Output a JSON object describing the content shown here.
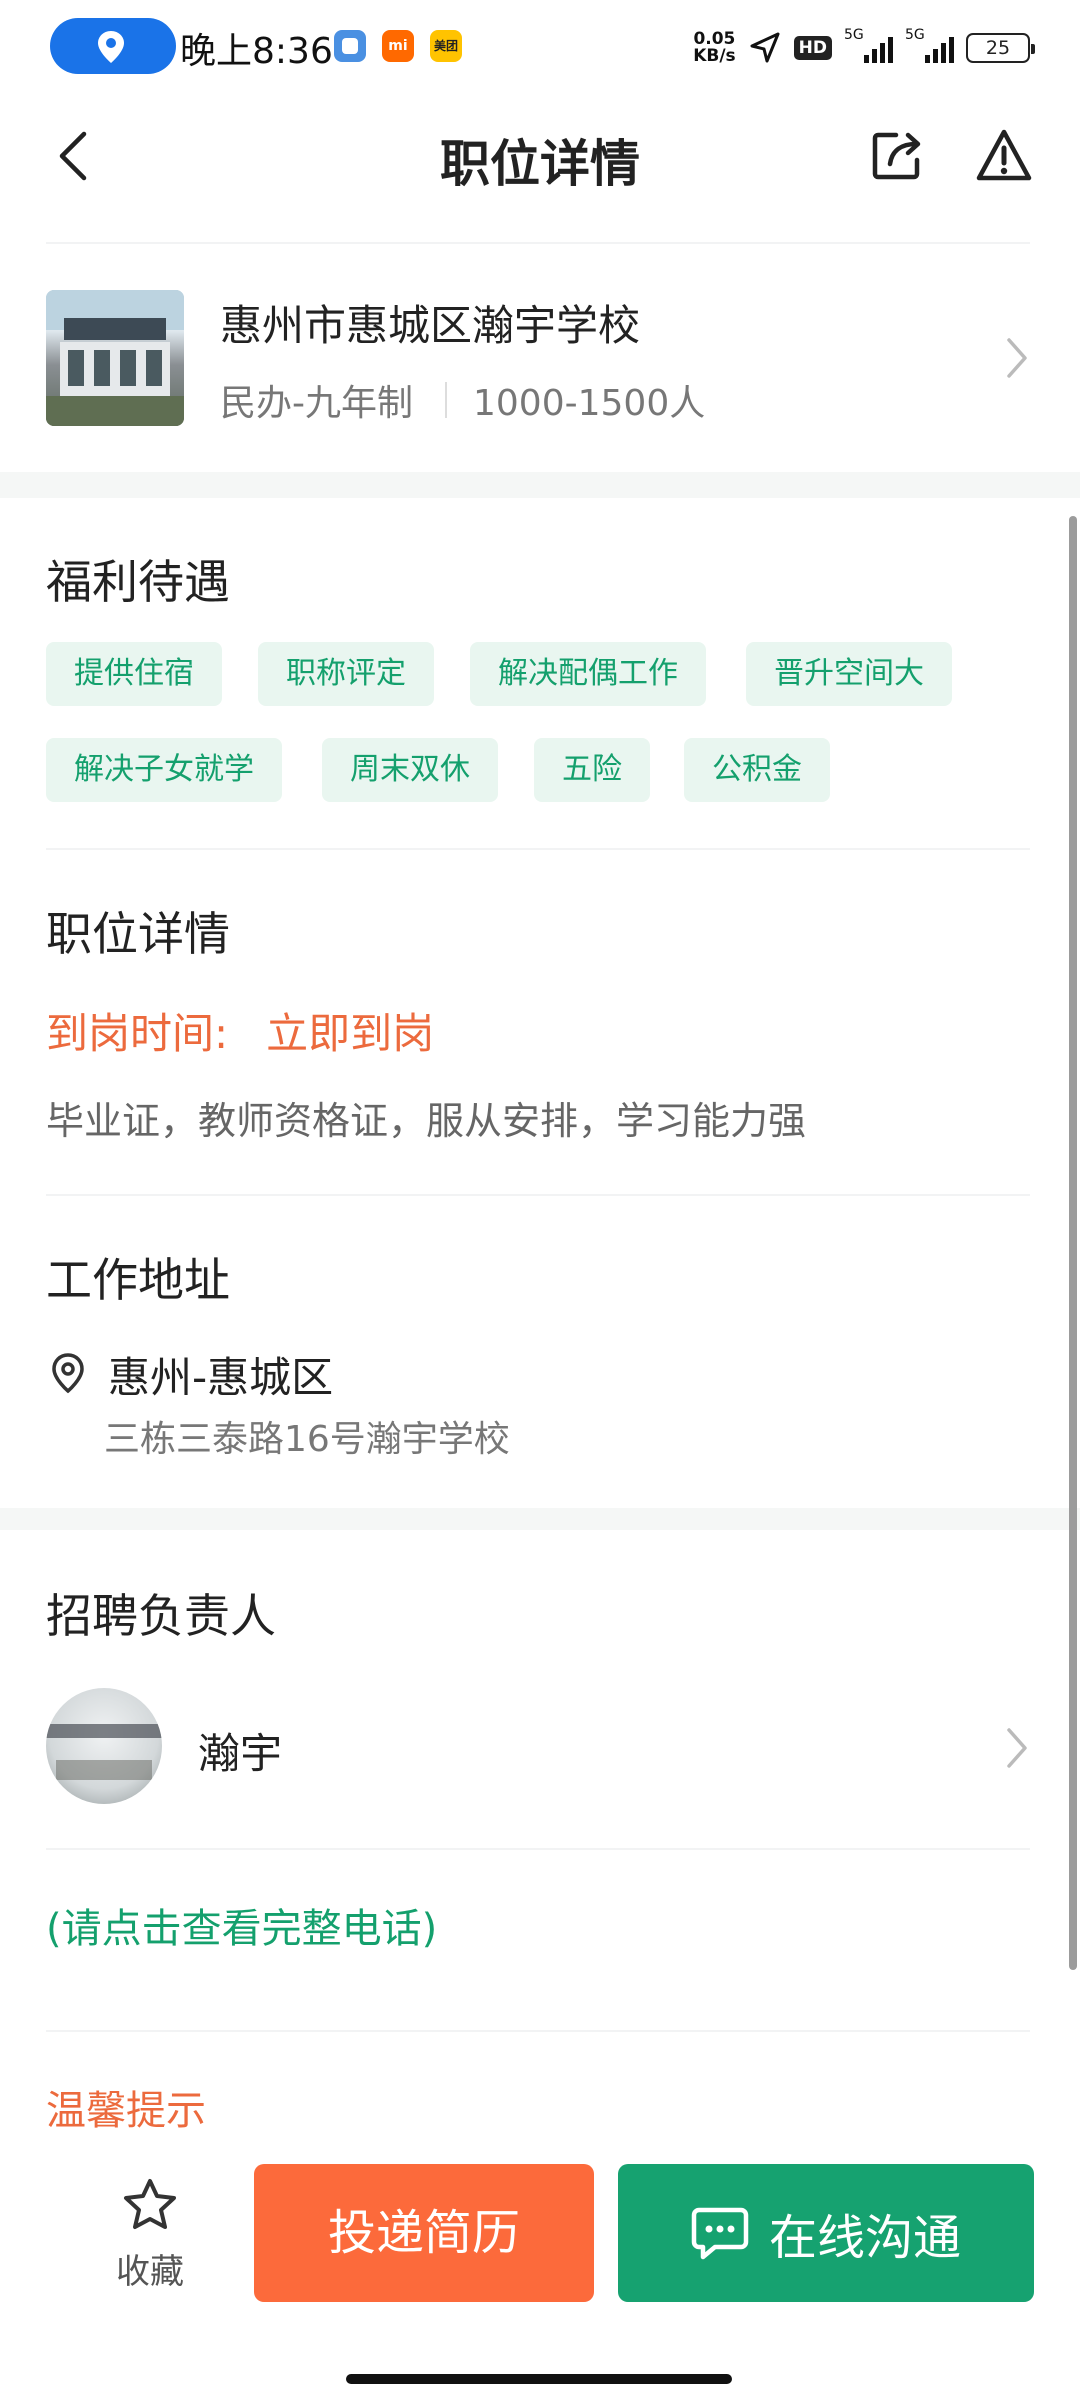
{
  "status_bar": {
    "time": "晚上8:36",
    "apps": [
      "mi",
      "美团"
    ],
    "net_speed_value": "0.05",
    "net_speed_unit": "KB/s",
    "hd_badge": "HD",
    "signal_1_label": "5G",
    "signal_2_label": "5G",
    "battery": "25"
  },
  "nav": {
    "title": "职位详情"
  },
  "school": {
    "name": "惠州市惠城区瀚宇学校",
    "type": "民办-九年制",
    "size": "1000-1500人"
  },
  "benefits": {
    "title": "福利待遇",
    "tags": [
      "提供住宿",
      "职称评定",
      "解决配偶工作",
      "晋升空间大",
      "解决子女就学",
      "周末双休",
      "五险",
      "公积金"
    ]
  },
  "job": {
    "title": "职位详情",
    "arrive_label": "到岗时间:",
    "arrive_value": "立即到岗",
    "requirements": "毕业证，教师资格证，服从安排，学习能力强"
  },
  "address": {
    "title": "工作地址",
    "city": "惠州-惠城区",
    "detail": "三栋三泰路16号瀚宇学校"
  },
  "recruiter": {
    "title": "招聘负责人",
    "name": "瀚宇",
    "phone_hint": "(请点击查看完整电话)"
  },
  "tips": {
    "title": "温馨提示"
  },
  "bottom": {
    "favorite_label": "收藏",
    "apply_label": "投递简历",
    "chat_label": "在线沟通"
  },
  "colors": {
    "accent_green": "#16a270",
    "accent_orange": "#fc6a3b",
    "tag_bg": "#e9f6f0"
  }
}
